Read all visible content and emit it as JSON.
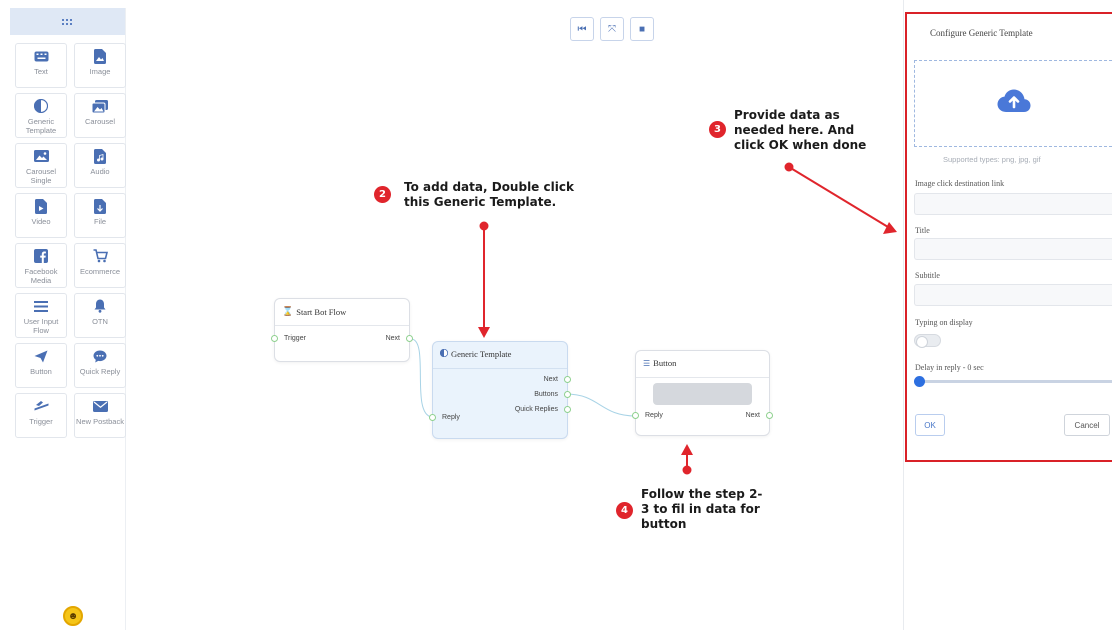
{
  "sidebar": {
    "header_icon": "grid-icon",
    "items": [
      {
        "label": "Text",
        "icon": "keyboard-icon"
      },
      {
        "label": "Image",
        "icon": "image-file-icon"
      },
      {
        "label": "Generic Template",
        "icon": "contrast-icon"
      },
      {
        "label": "Carousel",
        "icon": "gallery-icon"
      },
      {
        "label": "Carousel Single",
        "icon": "picture-icon"
      },
      {
        "label": "Audio",
        "icon": "audio-file-icon"
      },
      {
        "label": "Video",
        "icon": "video-file-icon"
      },
      {
        "label": "File",
        "icon": "file-icon"
      },
      {
        "label": "Facebook Media",
        "icon": "facebook-icon"
      },
      {
        "label": "Ecommerce",
        "icon": "cart-icon"
      },
      {
        "label": "User Input Flow",
        "icon": "list-icon"
      },
      {
        "label": "OTN",
        "icon": "bell-icon"
      },
      {
        "label": "Button",
        "icon": "send-icon"
      },
      {
        "label": "Quick Reply",
        "icon": "chat-bubble-icon"
      },
      {
        "label": "Trigger",
        "icon": "trigger-icon"
      },
      {
        "label": "New Postback",
        "icon": "envelope-icon"
      }
    ],
    "avatar_icon": "bot-avatar-icon"
  },
  "toolbar": {
    "buttons": [
      {
        "icon": "step-back-icon",
        "glyph": "⏮"
      },
      {
        "icon": "fit-screen-icon",
        "glyph": "⤧"
      },
      {
        "icon": "save-icon",
        "glyph": "■"
      }
    ]
  },
  "canvas": {
    "start_node": {
      "title": "Start Bot Flow",
      "in_port": "Trigger",
      "out_port": "Next"
    },
    "generic_node": {
      "title": "Generic Template",
      "outputs": [
        "Next",
        "Buttons",
        "Quick Replies"
      ],
      "in_port": "Reply"
    },
    "button_node": {
      "title": "Button",
      "in_port": "Reply",
      "out_port": "Next"
    }
  },
  "annotations": [
    {
      "badge": "2",
      "text": "To add data, Double click this Generic Template."
    },
    {
      "badge": "3",
      "text": "Provide data as needed here. And click OK when done"
    },
    {
      "badge": "4",
      "text": "Follow the step 2-3 to fil in data for button"
    }
  ],
  "accent_color": "#e0252c",
  "panel": {
    "title": "Configure Generic Template",
    "upload_icon": "cloud-upload-icon",
    "supported_types": "Supported types: png, jpg, gif",
    "fields": {
      "image_link_label": "Image click destination link",
      "image_link_value": "",
      "title_label": "Title",
      "title_value": "",
      "subtitle_label": "Subtitle",
      "subtitle_value": ""
    },
    "typing_label": "Typing on display",
    "typing_on": false,
    "delay_label": "Delay in reply  -  0 sec",
    "delay_value": 0,
    "ok_label": "OK",
    "cancel_label": "Cancel"
  }
}
